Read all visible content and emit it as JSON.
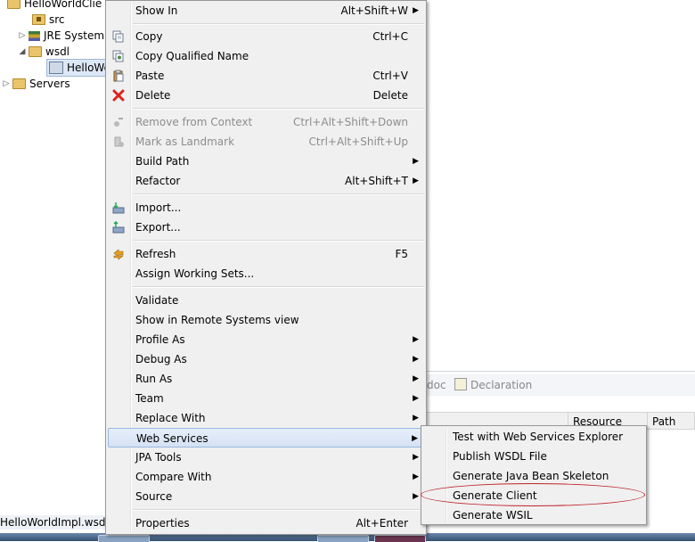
{
  "tree": {
    "project": "HelloWorldClie",
    "items": [
      {
        "label": "src",
        "icon": "source-folder-icon"
      },
      {
        "label": "JRE System",
        "icon": "library-icon"
      },
      {
        "label": "wsdl",
        "icon": "folder-icon"
      },
      {
        "label": "HelloWo",
        "icon": "wsdl-file-icon"
      },
      {
        "label": "Servers",
        "icon": "folder-icon"
      }
    ]
  },
  "status_bar": "HelloWorldImpl.wsdl - H",
  "panel": {
    "tab_partial": "doc",
    "tab_declaration": "Declaration",
    "columns": [
      "Resource",
      "Path"
    ]
  },
  "context_menu": {
    "items": [
      {
        "label": "Show In",
        "shortcut": "Alt+Shift+W",
        "submenu": true
      },
      {
        "label": "Copy",
        "shortcut": "Ctrl+C",
        "icon": "copy-icon"
      },
      {
        "label": "Copy Qualified Name",
        "shortcut": "",
        "icon": "copy-qualified-icon"
      },
      {
        "label": "Paste",
        "shortcut": "Ctrl+V",
        "icon": "paste-icon"
      },
      {
        "label": "Delete",
        "shortcut": "Delete",
        "icon": "delete-icon"
      },
      {
        "label": "Remove from Context",
        "shortcut": "Ctrl+Alt+Shift+Down",
        "disabled": true,
        "icon": "remove-context-icon"
      },
      {
        "label": "Mark as Landmark",
        "shortcut": "Ctrl+Alt+Shift+Up",
        "disabled": true,
        "icon": "landmark-icon"
      },
      {
        "label": "Build Path",
        "shortcut": "",
        "submenu": true
      },
      {
        "label": "Refactor",
        "shortcut": "Alt+Shift+T",
        "submenu": true
      },
      {
        "label": "Import...",
        "shortcut": "",
        "icon": "import-icon"
      },
      {
        "label": "Export...",
        "shortcut": "",
        "icon": "export-icon"
      },
      {
        "label": "Refresh",
        "shortcut": "F5",
        "icon": "refresh-icon"
      },
      {
        "label": "Assign Working Sets...",
        "shortcut": ""
      },
      {
        "label": "Validate",
        "shortcut": ""
      },
      {
        "label": "Show in Remote Systems view",
        "shortcut": ""
      },
      {
        "label": "Profile As",
        "shortcut": "",
        "submenu": true
      },
      {
        "label": "Debug As",
        "shortcut": "",
        "submenu": true
      },
      {
        "label": "Run As",
        "shortcut": "",
        "submenu": true
      },
      {
        "label": "Team",
        "shortcut": "",
        "submenu": true
      },
      {
        "label": "Replace With",
        "shortcut": "",
        "submenu": true
      },
      {
        "label": "Web Services",
        "shortcut": "",
        "submenu": true,
        "highlighted": true
      },
      {
        "label": "JPA Tools",
        "shortcut": "",
        "submenu": true
      },
      {
        "label": "Compare With",
        "shortcut": "",
        "submenu": true
      },
      {
        "label": "Source",
        "shortcut": "",
        "submenu": true
      },
      {
        "label": "Properties",
        "shortcut": "Alt+Enter"
      }
    ]
  },
  "submenu": {
    "items": [
      {
        "label": "Test with Web Services Explorer"
      },
      {
        "label": "Publish WSDL File"
      },
      {
        "label": "Generate Java Bean Skeleton"
      },
      {
        "label": "Generate Client",
        "annotated": true
      },
      {
        "label": "Generate WSIL"
      }
    ]
  },
  "colors": {
    "highlight": "#d5e2f4",
    "annotation": "#c0242b"
  }
}
